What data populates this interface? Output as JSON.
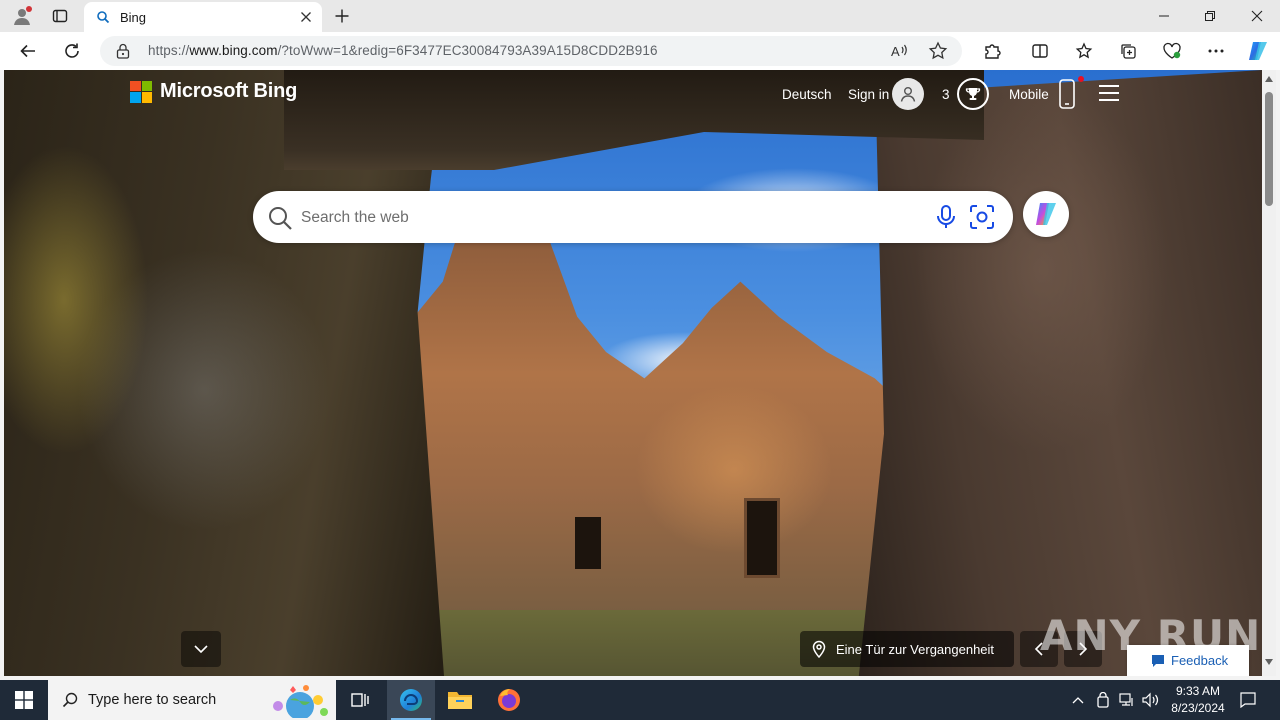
{
  "browser": {
    "tab": {
      "title": "Bing",
      "icon": "search-icon"
    },
    "url": {
      "prefix": "https://",
      "host": "www.bing.com",
      "rest": "/?toWww=1&redig=6F3477EC30084793A39A15D8CDD2B916"
    },
    "colors": {
      "tab_strip": "#e8e8e8",
      "toolbar": "#ffffff"
    }
  },
  "bing": {
    "logo_text": "Microsoft Bing",
    "language_link": "Deutsch",
    "sign_in": "Sign in",
    "rewards_count": "3",
    "mobile": "Mobile",
    "search_placeholder": "Search the web",
    "image_caption": "Eine Tür zur Vergangenheit",
    "feedback": "Feedback",
    "watermark": "ANY RUN"
  },
  "taskbar": {
    "search_placeholder": "Type here to search",
    "time": "9:33 AM",
    "date": "8/23/2024",
    "apps": [
      "task-view",
      "edge",
      "file-explorer",
      "firefox"
    ]
  }
}
